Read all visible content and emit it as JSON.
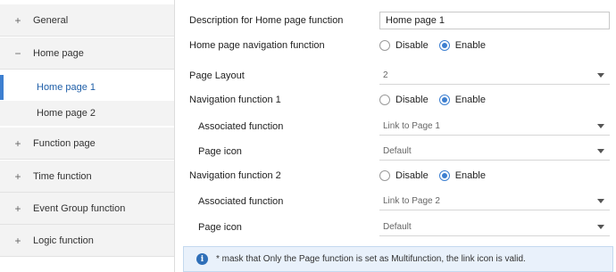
{
  "sidebar": {
    "items": [
      {
        "sign": "+",
        "label": "General"
      },
      {
        "sign": "−",
        "label": "Home page"
      },
      {
        "sign": "+",
        "label": "Function page"
      },
      {
        "sign": "+",
        "label": "Time function"
      },
      {
        "sign": "+",
        "label": "Event Group function"
      },
      {
        "sign": "+",
        "label": "Logic function"
      }
    ],
    "sub_items": [
      {
        "label": "Home page 1",
        "active": true
      },
      {
        "label": "Home page 2",
        "active": false
      }
    ]
  },
  "form": {
    "description": {
      "label": "Description for Home page function",
      "value": "Home page 1"
    },
    "home_nav": {
      "label": "Home page navigation function",
      "option_disable": "Disable",
      "option_enable": "Enable",
      "selected": "Enable"
    },
    "page_layout": {
      "label": "Page Layout",
      "value": "2"
    },
    "nav1": {
      "label": "Navigation function 1",
      "option_disable": "Disable",
      "option_enable": "Enable",
      "selected": "Enable"
    },
    "nav1_assoc": {
      "label": "Associated function",
      "value": "Link to Page 1"
    },
    "nav1_icon": {
      "label": "Page icon",
      "value": "Default"
    },
    "nav2": {
      "label": "Navigation function 2",
      "option_disable": "Disable",
      "option_enable": "Enable",
      "selected": "Enable"
    },
    "nav2_assoc": {
      "label": "Associated function",
      "value": "Link to Page 2"
    },
    "nav2_icon": {
      "label": "Page icon",
      "value": "Default"
    }
  },
  "note": {
    "icon": "info-icon",
    "text": "* mask that Only the Page function is set as Multifunction, the link icon  is valid."
  },
  "colors": {
    "accent": "#3d7fd0",
    "note_bg": "#e9f1fb",
    "sidebar_bg": "#f3f3f3"
  }
}
